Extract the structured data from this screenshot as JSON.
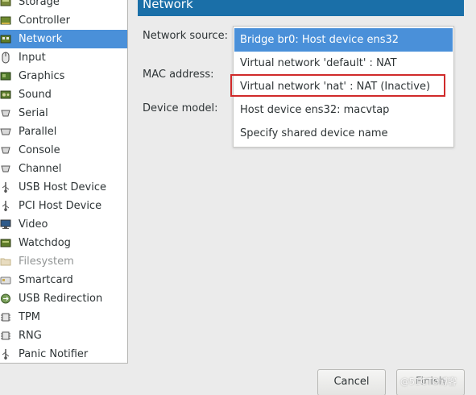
{
  "sidebar": {
    "items": [
      {
        "label": "Storage",
        "icon": "storage-icon"
      },
      {
        "label": "Controller",
        "icon": "controller-icon"
      },
      {
        "label": "Network",
        "icon": "network-icon",
        "selected": true
      },
      {
        "label": "Input",
        "icon": "mouse-icon"
      },
      {
        "label": "Graphics",
        "icon": "graphics-card-icon"
      },
      {
        "label": "Sound",
        "icon": "sound-card-icon"
      },
      {
        "label": "Serial",
        "icon": "serial-port-icon"
      },
      {
        "label": "Parallel",
        "icon": "parallel-port-icon"
      },
      {
        "label": "Console",
        "icon": "console-icon"
      },
      {
        "label": "Channel",
        "icon": "channel-icon"
      },
      {
        "label": "USB Host Device",
        "icon": "usb-icon"
      },
      {
        "label": "PCI Host Device",
        "icon": "pci-icon"
      },
      {
        "label": "Video",
        "icon": "monitor-icon"
      },
      {
        "label": "Watchdog",
        "icon": "watchdog-icon"
      },
      {
        "label": "Filesystem",
        "icon": "folder-icon",
        "disabled": true
      },
      {
        "label": "Smartcard",
        "icon": "smartcard-icon"
      },
      {
        "label": "USB Redirection",
        "icon": "usb-redirection-icon"
      },
      {
        "label": "TPM",
        "icon": "tpm-chip-icon"
      },
      {
        "label": "RNG",
        "icon": "rng-icon"
      },
      {
        "label": "Panic Notifier",
        "icon": "panic-notifier-icon"
      }
    ]
  },
  "panel": {
    "title": "Network",
    "network_source_label": "Network source:",
    "mac_address_label": "MAC address:",
    "device_model_label": "Device model:"
  },
  "network_source_menu": {
    "selected_index": 0,
    "highlighted_index": 2,
    "options": [
      "Bridge br0: Host device ens32",
      "Virtual network 'default' : NAT",
      "Virtual network 'nat' : NAT (Inactive)",
      "Host device ens32: macvtap",
      "Specify shared device name"
    ]
  },
  "buttons": {
    "cancel": "Cancel",
    "finish": "Finish"
  },
  "watermark": "@51CTO博客",
  "colors": {
    "selection": "#4a90d9",
    "header": "#1a6fa8",
    "highlight_box": "#d02a2a"
  }
}
